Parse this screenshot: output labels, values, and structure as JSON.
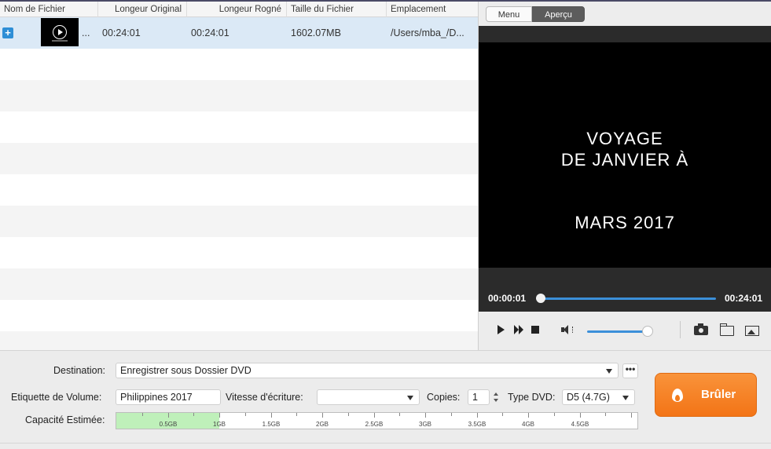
{
  "table": {
    "columns": [
      "Nom de Fichier",
      "Longeur Original",
      "Longeur Rogné",
      "Taille du Fichier",
      "Emplacement"
    ],
    "rows": [
      {
        "name": "...",
        "original_length": "00:24:01",
        "trimmed_length": "00:24:01",
        "file_size": "1602.07MB",
        "location": "/Users/mba_/D..."
      }
    ]
  },
  "preview": {
    "tabs": [
      "Menu",
      "Aperçu"
    ],
    "active_tab": "Aperçu",
    "video_text": [
      "VOYAGE",
      "DE JANVIER À",
      "MARS 2017"
    ],
    "current_time": "00:00:01",
    "total_time": "00:24:01",
    "playback_progress": 0.0007,
    "volume_level": 0.9,
    "icons": [
      "play-icon",
      "fast-forward-icon",
      "stop-icon",
      "volume-icon",
      "camera-icon",
      "folder-icon",
      "image-icon"
    ]
  },
  "settings": {
    "destination_label": "Destination:",
    "destination_value": "Enregistrer sous Dossier DVD",
    "more_label": "•••",
    "volume_label_label": "Etiquette de Volume:",
    "volume_label_value": "Philippines 2017",
    "write_speed_label": "Vitesse d'écriture:",
    "write_speed_value": "",
    "copies_label": "Copies:",
    "copies_value": "1",
    "dvd_type_label": "Type DVD:",
    "dvd_type_value": "D5 (4.7G)",
    "capacity_label": "Capacité Estimée:",
    "capacity_ticks": [
      "0.5GB",
      "1GB",
      "1.5GB",
      "2GB",
      "2.5GB",
      "3GB",
      "3.5GB",
      "4GB",
      "4.5GB"
    ],
    "capacity_used_gb": 1.0,
    "capacity_max_gb": 5.0
  },
  "burn_button": {
    "label": "Brûler"
  },
  "colors": {
    "accent_blue": "#3b8fd9",
    "burn_orange": "#f37416",
    "selected_row": "#dbe9f6",
    "capacity_fill": "#bff0ba"
  }
}
